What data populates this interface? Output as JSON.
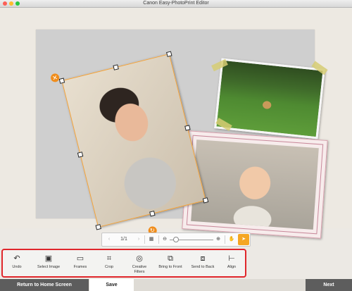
{
  "window": {
    "title": "Canon Easy-PhotoPrint Editor"
  },
  "canvas": {
    "photos": [
      {
        "subject": "toddler-eating",
        "selected": true
      },
      {
        "subject": "dog-on-grass",
        "decoration": "tape"
      },
      {
        "subject": "smiling-baby",
        "decoration": "pink-frame"
      }
    ]
  },
  "navbar": {
    "prev_icon": "‹",
    "page": "1/1",
    "next_icon": "›",
    "grid_icon": "▦",
    "zoom_out_icon": "⊖",
    "zoom_in_icon": "⊕",
    "hand_icon": "✋",
    "select_icon": "➤",
    "zoom_level": 0.1
  },
  "toolbar": {
    "tools": [
      {
        "label": "Undo",
        "icon": "↶"
      },
      {
        "label": "Select Image",
        "icon": "▣"
      },
      {
        "label": "Frames",
        "icon": "▭"
      },
      {
        "label": "Crop",
        "icon": "⌗"
      },
      {
        "label": "Creative Filters",
        "icon": "◎"
      },
      {
        "label": "Bring to Front",
        "icon": "⧉"
      },
      {
        "label": "Send to Back",
        "icon": "⧈"
      },
      {
        "label": "Align",
        "icon": "⊢"
      }
    ]
  },
  "bottom": {
    "home_label": "Return to Home Screen",
    "save_label": "Save",
    "next_label": "Next"
  },
  "colors": {
    "accent": "#f5a623",
    "highlight_box": "#e0262b",
    "dark_button": "#5d5d5d"
  }
}
